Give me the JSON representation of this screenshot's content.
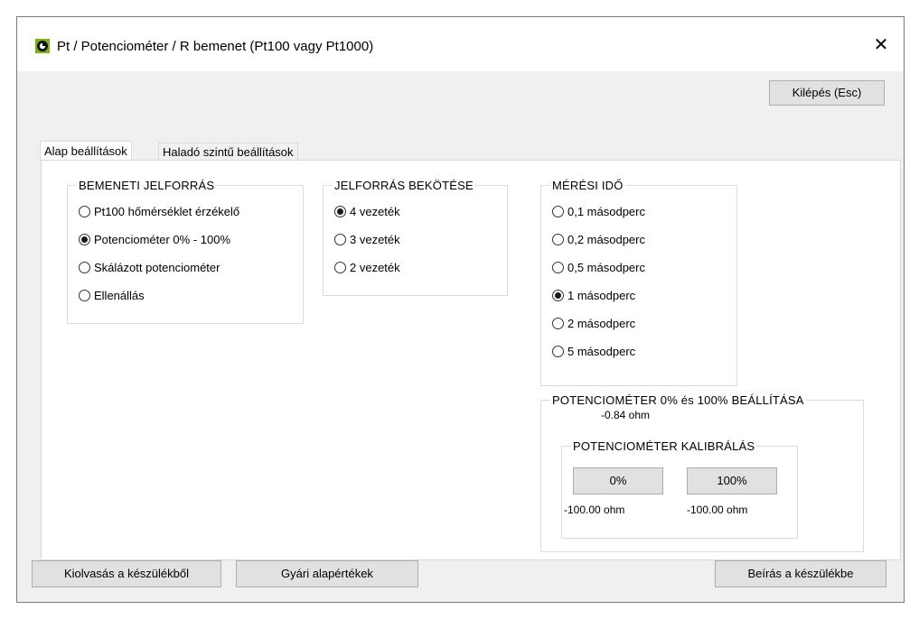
{
  "window": {
    "title": "Pt / Potenciométer / R bemenet (Pt100 vagy Pt1000)",
    "close_glyph": "✕"
  },
  "buttons": {
    "exit": "Kilépés (Esc)",
    "read": "Kiolvasás a készülékből",
    "factory": "Gyári alapértékek",
    "write": "Beírás a készülékbe"
  },
  "tabs": [
    {
      "label": "Alap beállítások",
      "active": true
    },
    {
      "label": "Haladó szintű beállítások",
      "active": false
    }
  ],
  "source_group": {
    "title": "BEMENETI JELFORRÁS",
    "options": [
      {
        "label": "Pt100 hőmérséklet érzékelő",
        "checked": false
      },
      {
        "label": "Potenciométer 0% - 100%",
        "checked": true
      },
      {
        "label": "Skálázott potenciométer",
        "checked": false
      },
      {
        "label": "Ellenállás",
        "checked": false
      }
    ]
  },
  "wiring_group": {
    "title": "JELFORRÁS BEKÖTÉSE",
    "options": [
      {
        "label": "4 vezeték",
        "checked": true
      },
      {
        "label": "3 vezeték",
        "checked": false
      },
      {
        "label": "2 vezeték",
        "checked": false
      }
    ]
  },
  "time_group": {
    "title": "MÉRÉSI IDŐ",
    "options": [
      {
        "label": "0,1 másodperc",
        "checked": false
      },
      {
        "label": "0,2 másodperc",
        "checked": false
      },
      {
        "label": "0,5 másodperc",
        "checked": false
      },
      {
        "label": "1 másodperc",
        "checked": true
      },
      {
        "label": "2 másodperc",
        "checked": false
      },
      {
        "label": "5 másodperc",
        "checked": false
      }
    ]
  },
  "pot_group": {
    "title": "POTENCIOMÉTER 0% és 100% BEÁLLÍTÁSA",
    "current_value": "-0.84 ohm",
    "calib": {
      "title": "POTENCIOMÉTER KALIBRÁLÁS",
      "btn_0": "0%",
      "btn_100": "100%",
      "value_0": "-100.00 ohm",
      "value_100": "-100.00 ohm"
    }
  }
}
